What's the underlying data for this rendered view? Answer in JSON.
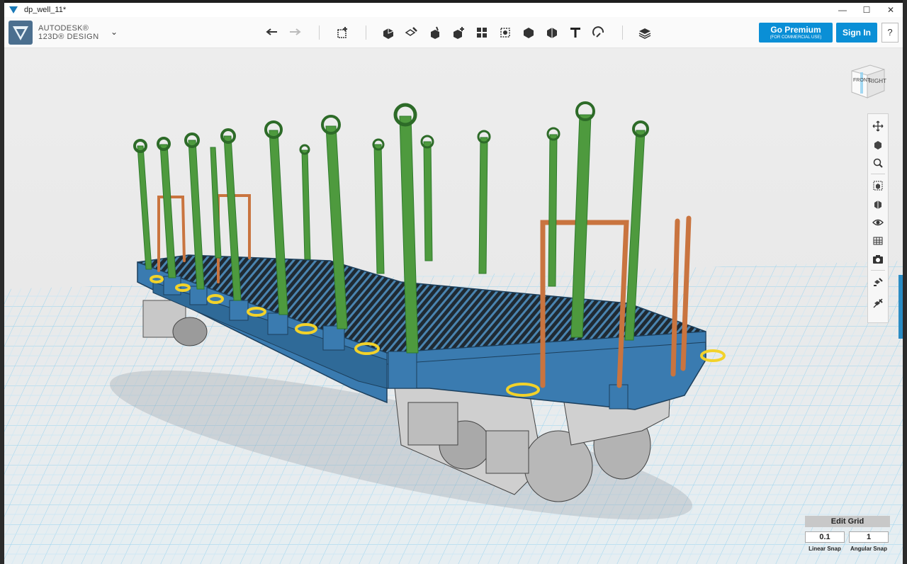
{
  "window": {
    "title": "dp_well_11*"
  },
  "app": {
    "brand_line1": "AUTODESK®",
    "brand_line2": "123D® DESIGN"
  },
  "toolbar": {
    "tools": [
      "undo-icon",
      "redo-icon",
      "primitives-icon",
      "sketch-icon",
      "construct-icon",
      "modify-icon",
      "pattern-icon",
      "group-icon",
      "combine-icon",
      "measure-icon",
      "text-icon",
      "snap-icon",
      "materials-icon"
    ]
  },
  "account": {
    "premium_label": "Go Premium",
    "premium_sub": "(FOR COMMERCIAL USE)",
    "signin_label": "Sign In",
    "help_label": "?"
  },
  "viewcube": {
    "front": "FRONT",
    "right": "RIGHT"
  },
  "grid": {
    "title": "Edit Grid",
    "linear_snap": "0.1",
    "angular_snap": "1",
    "linear_label": "Linear Snap",
    "angular_label": "Angular Snap"
  }
}
